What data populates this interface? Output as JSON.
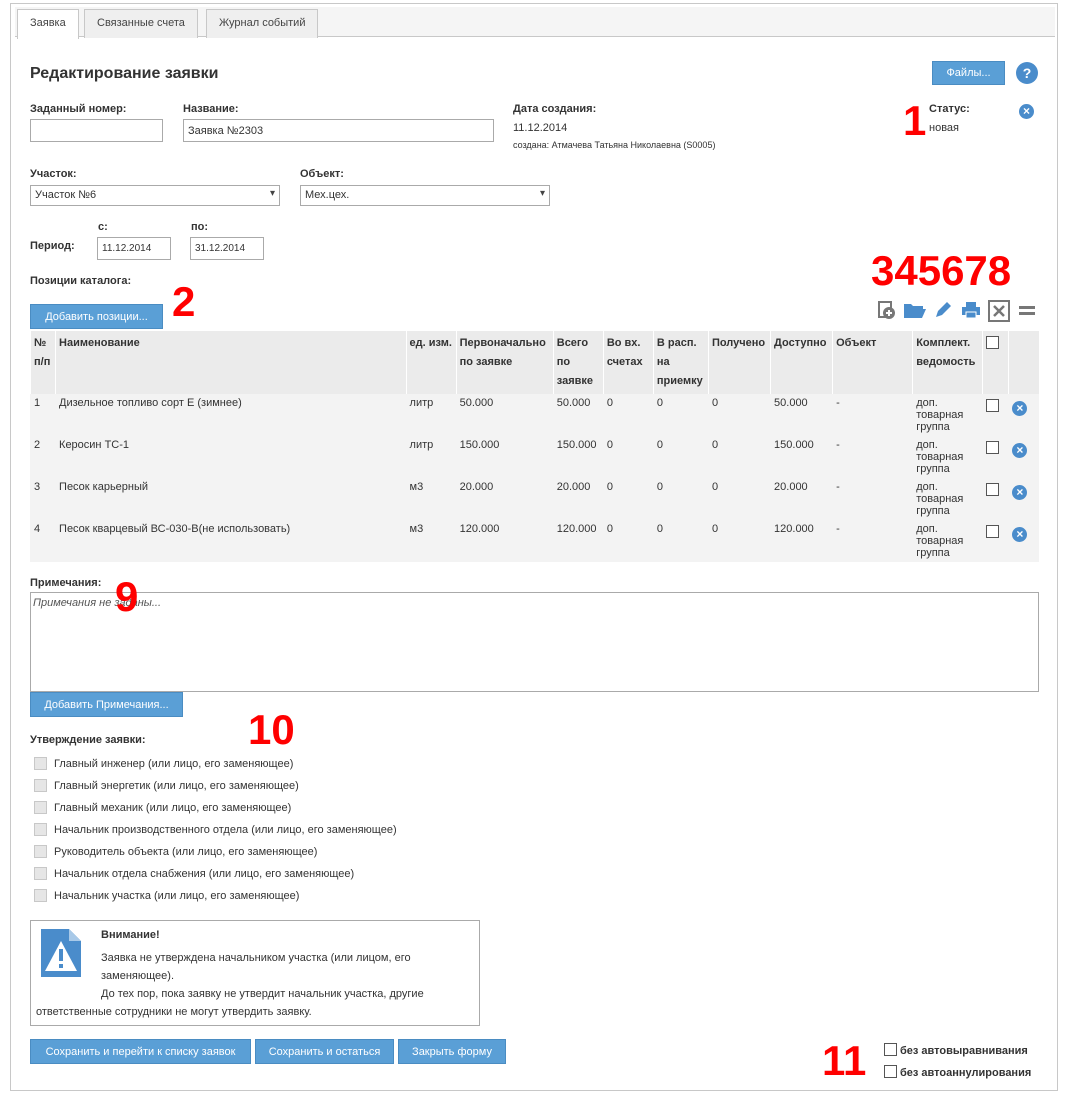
{
  "tabs": [
    "Заявка",
    "Связанные счета",
    "Журнал событий"
  ],
  "header": {
    "title": "Редактирование заявки",
    "files_button": "Файлы...",
    "help_icon": "?"
  },
  "fields": {
    "number_label": "Заданный номер:",
    "number_value": "",
    "name_label": "Название:",
    "name_value": "Заявка №2303",
    "created_label": "Дата создания:",
    "created_date": "11.12.2014",
    "created_by": "создана: Атмачева Татьяна Николаевна (S0005)",
    "status_label": "Статус:",
    "status_value": "новая",
    "site_label": "Участок:",
    "site_value": "Участок №6",
    "object_label": "Объект:",
    "object_value": "Мех.цех.",
    "period_label": "Период:",
    "from_label": "с:",
    "from_value": "11.12.2014",
    "to_label": "по:",
    "to_value": "31.12.2014"
  },
  "catalog": {
    "label": "Позиции каталога:",
    "add_button": "Добавить позиции...",
    "columns": [
      "№ п/п",
      "Наименование",
      "ед. изм.",
      "Первоначально по заявке",
      "Всего по заявке",
      "Во вх. счетах",
      "В расп. на приемку",
      "Получено",
      "Доступно",
      "Объект",
      "Комплект. ведомость"
    ],
    "rows": [
      [
        "1",
        "Дизельное топливо сорт Е (зимнее)",
        "литр",
        "50.000",
        "50.000",
        "0",
        "0",
        "0",
        "50.000",
        "-",
        "доп. товарная группа"
      ],
      [
        "2",
        "Керосин ТС-1",
        "литр",
        "150.000",
        "150.000",
        "0",
        "0",
        "0",
        "150.000",
        "-",
        "доп. товарная группа"
      ],
      [
        "3",
        "Песок карьерный",
        "м3",
        "20.000",
        "20.000",
        "0",
        "0",
        "0",
        "20.000",
        "-",
        "доп. товарная группа"
      ],
      [
        "4",
        "Песок кварцевый ВС-030-В(не использовать)",
        "м3",
        "120.000",
        "120.000",
        "0",
        "0",
        "0",
        "120.000",
        "-",
        "доп. товарная группа"
      ]
    ]
  },
  "notes": {
    "label": "Примечания:",
    "placeholder": "Примечания не заданы...",
    "add_button": "Добавить Примечания..."
  },
  "approval": {
    "label": "Утверждение заявки:",
    "items": [
      "Главный инженер (или лицо, его заменяющее)",
      "Главный энергетик (или лицо, его заменяющее)",
      "Главный механик (или лицо, его заменяющее)",
      "Начальник производственного отдела (или лицо, его заменяющее)",
      "Руководитель объекта (или лицо, его заменяющее)",
      "Начальник отдела снабжения (или лицо, его заменяющее)",
      "Начальник участка (или лицо, его заменяющее)"
    ]
  },
  "warning": {
    "title": "Внимание!",
    "line1": "Заявка не утверждена начальником участка (или лицом, его",
    "line2": "заменяющее).",
    "line3": "До тех пор, пока заявку не утвердит начальник участка, другие",
    "line4": "ответственные сотрудники не могут утвердить заявку."
  },
  "footer": {
    "save_go": "Сохранить и перейти к списку заявок",
    "save_stay": "Сохранить и остаться",
    "close": "Закрыть форму",
    "no_align": "без автовыравнивания",
    "no_cancel": "без автоаннулирования"
  },
  "markers": [
    "1",
    "2",
    "345678",
    "9",
    "10",
    "11"
  ],
  "colors": {
    "button": "#5a9fd6",
    "marker": "#ff0000",
    "icon_blue": "#4a8ccb"
  }
}
